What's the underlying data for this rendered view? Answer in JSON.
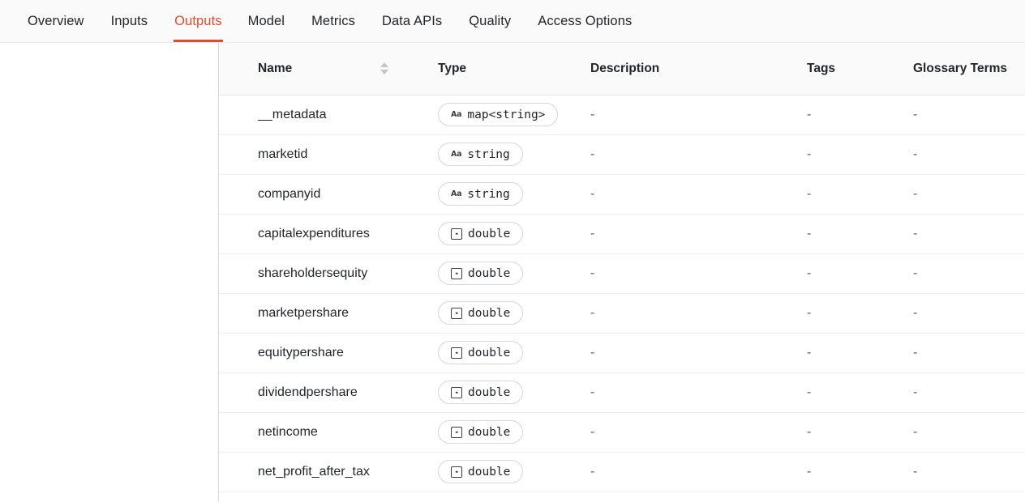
{
  "nav": {
    "tabs": [
      {
        "label": "Overview",
        "active": false
      },
      {
        "label": "Inputs",
        "active": false
      },
      {
        "label": "Outputs",
        "active": true
      },
      {
        "label": "Model",
        "active": false
      },
      {
        "label": "Metrics",
        "active": false
      },
      {
        "label": "Data APIs",
        "active": false
      },
      {
        "label": "Quality",
        "active": false
      },
      {
        "label": "Access Options",
        "active": false
      }
    ],
    "active_tab": "Outputs",
    "accent_color": "#e8482a"
  },
  "table": {
    "columns": [
      {
        "id": "name",
        "label": "Name",
        "sortable": true,
        "sort_icon": "sort-updown-icon"
      },
      {
        "id": "type",
        "label": "Type",
        "sortable": false
      },
      {
        "id": "description",
        "label": "Description",
        "sortable": false
      },
      {
        "id": "tags",
        "label": "Tags",
        "sortable": false
      },
      {
        "id": "glossary_terms",
        "label": "Glossary Terms",
        "sortable": false
      }
    ],
    "empty_value": "-",
    "rows": [
      {
        "name": "__metadata",
        "type": "map<string>",
        "type_icon": "text-aa-icon",
        "description": "-",
        "tags": "-",
        "glossary_terms": "-"
      },
      {
        "name": "marketid",
        "type": "string",
        "type_icon": "text-aa-icon",
        "description": "-",
        "tags": "-",
        "glossary_terms": "-"
      },
      {
        "name": "companyid",
        "type": "string",
        "type_icon": "text-aa-icon",
        "description": "-",
        "tags": "-",
        "glossary_terms": "-"
      },
      {
        "name": "capitalexpenditures",
        "type": "double",
        "type_icon": "decimal-number-icon",
        "description": "-",
        "tags": "-",
        "glossary_terms": "-"
      },
      {
        "name": "shareholdersequity",
        "type": "double",
        "type_icon": "decimal-number-icon",
        "description": "-",
        "tags": "-",
        "glossary_terms": "-"
      },
      {
        "name": "marketpershare",
        "type": "double",
        "type_icon": "decimal-number-icon",
        "description": "-",
        "tags": "-",
        "glossary_terms": "-"
      },
      {
        "name": "equitypershare",
        "type": "double",
        "type_icon": "decimal-number-icon",
        "description": "-",
        "tags": "-",
        "glossary_terms": "-"
      },
      {
        "name": "dividendpershare",
        "type": "double",
        "type_icon": "decimal-number-icon",
        "description": "-",
        "tags": "-",
        "glossary_terms": "-"
      },
      {
        "name": "netincome",
        "type": "double",
        "type_icon": "decimal-number-icon",
        "description": "-",
        "tags": "-",
        "glossary_terms": "-"
      },
      {
        "name": "net_profit_after_tax",
        "type": "double",
        "type_icon": "decimal-number-icon",
        "description": "-",
        "tags": "-",
        "glossary_terms": "-"
      }
    ]
  }
}
